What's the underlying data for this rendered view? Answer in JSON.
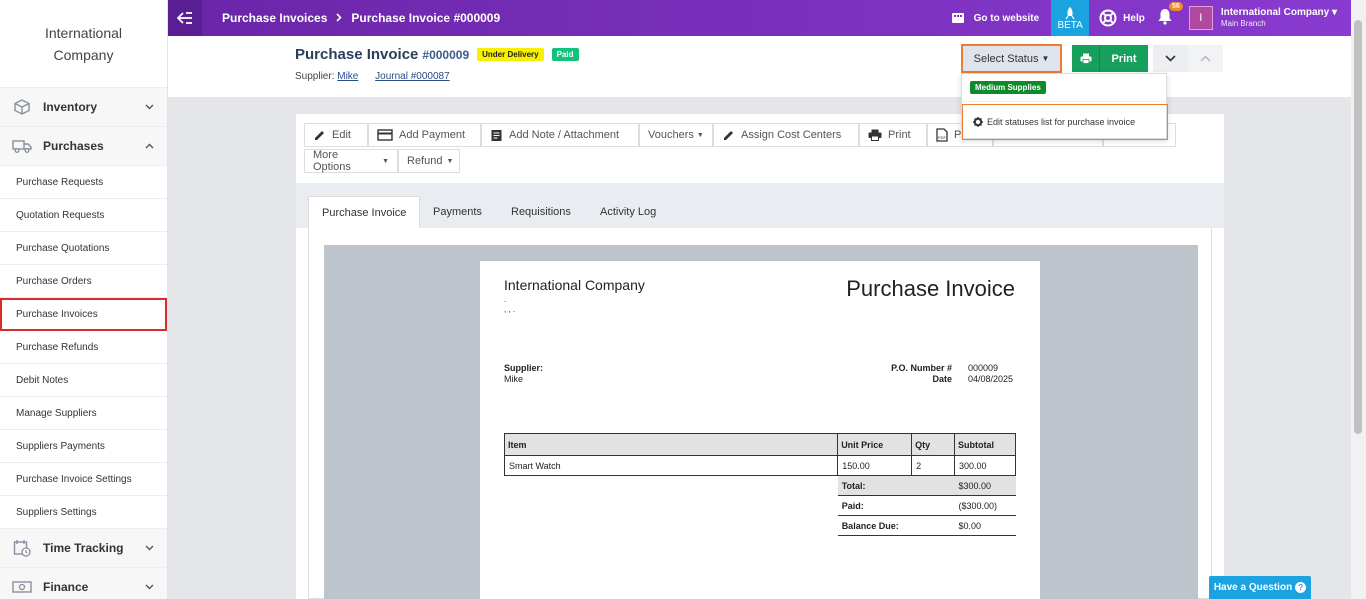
{
  "sidebar": {
    "brand": "International Company",
    "groups": {
      "inventory": "Inventory",
      "purchases": "Purchases",
      "time_tracking": "Time Tracking",
      "finance": "Finance"
    },
    "items": [
      "Purchase Requests",
      "Quotation Requests",
      "Purchase Quotations",
      "Purchase Orders",
      "Purchase Invoices",
      "Purchase Refunds",
      "Debit Notes",
      "Manage Suppliers",
      "Suppliers Payments",
      "Purchase Invoice Settings",
      "Suppliers Settings"
    ]
  },
  "topbar": {
    "crumb1": "Purchase Invoices",
    "crumb2": "Purchase Invoice #000009",
    "go_to_website": "Go to website",
    "beta": "BETA",
    "help": "Help",
    "notifications": "56",
    "avatar_initial": "I",
    "account_name": "International Company",
    "account_branch": "Main Branch"
  },
  "header": {
    "title": "Purchase Invoice",
    "number": "#000009",
    "badge_delivery": "Under Delivery",
    "badge_paid": "Paid",
    "supplier_label": "Supplier:",
    "supplier_name": "Mike",
    "journal": "Journal #000087",
    "select_status": "Select Status",
    "print": "Print"
  },
  "status_dropdown": {
    "option": "Medium Supplies",
    "edit_link": "Edit statuses list for purchase invoice"
  },
  "toolbar": {
    "edit": "Edit",
    "add_payment": "Add Payment",
    "add_note": "Add Note / Attachment",
    "vouchers": "Vouchers",
    "assign_cost": "Assign Cost Centers",
    "print": "Print",
    "pdf": "PDF",
    "more_options": "More Options",
    "refund": "Refund"
  },
  "tabs": [
    "Purchase Invoice",
    "Payments",
    "Requisitions",
    "Activity Log"
  ],
  "invoice": {
    "company": "International Company",
    "company_line1": ".",
    "company_line2": ", , .",
    "title": "Purchase Invoice",
    "supplier_label": "Supplier:",
    "supplier_name": "Mike",
    "po_label": "P.O. Number #",
    "po_value": "000009",
    "date_label": "Date",
    "date_value": "04/08/2025",
    "columns": [
      "Item",
      "Unit Price",
      "Qty",
      "Subtotal"
    ],
    "rows": [
      {
        "item": "Smart Watch",
        "unit_price": "150.00",
        "qty": "2",
        "subtotal": "300.00"
      }
    ],
    "total_label": "Total:",
    "total_value": "$300.00",
    "paid_label": "Paid:",
    "paid_value": "($300.00)",
    "due_label": "Balance Due:",
    "due_value": "$0.00"
  },
  "help_widget": "Have a Question"
}
